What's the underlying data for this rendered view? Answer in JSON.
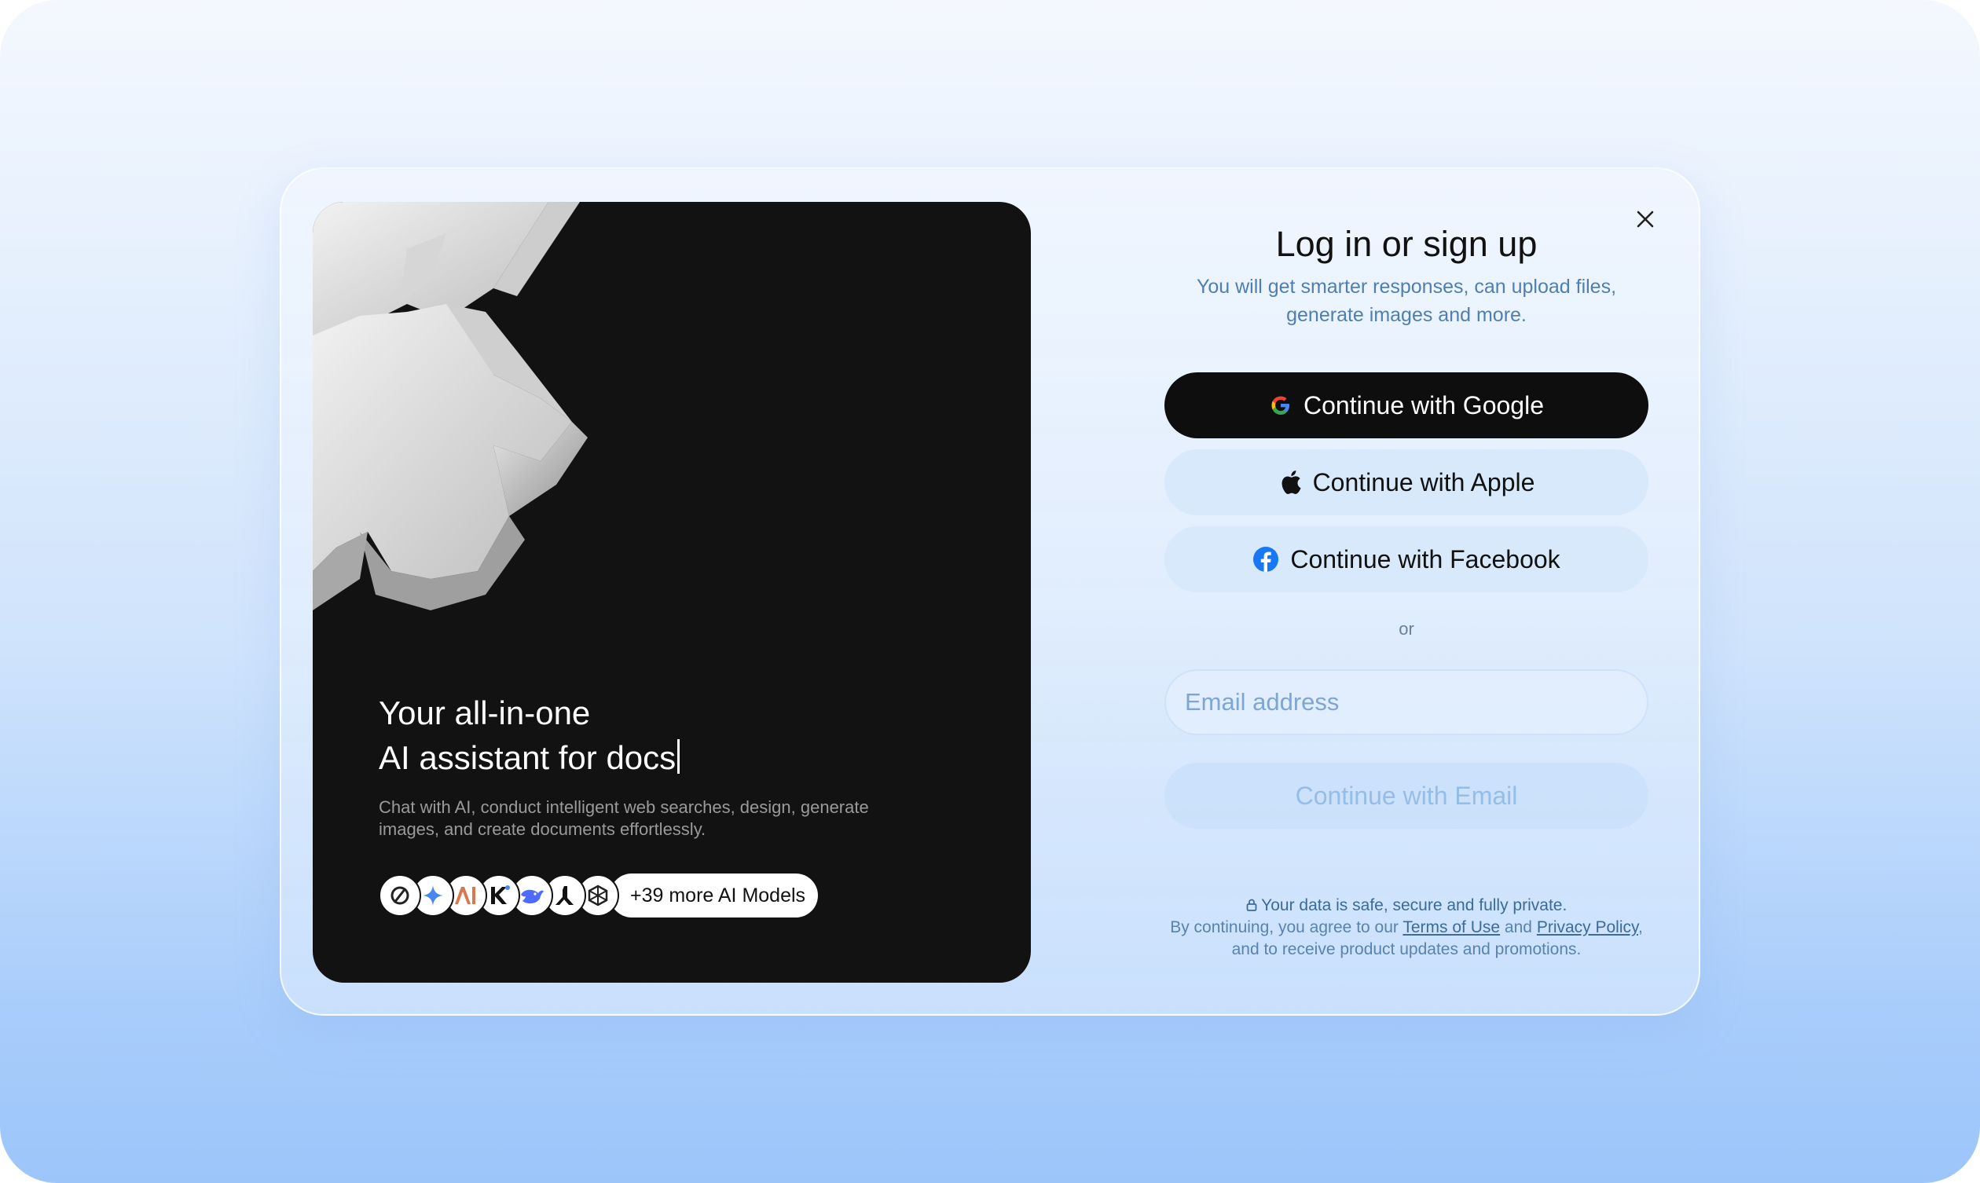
{
  "modal": {
    "close_icon": "close-icon",
    "title": "Log in or sign up",
    "subtitle_line1": "You will get smarter responses, can upload files,",
    "subtitle_line2": "generate images and more."
  },
  "hero": {
    "title_line1": "Your all-in-one",
    "title_line2": "AI assistant for docs",
    "description_line1": "Chat with AI, conduct intelligent web searches, design, generate",
    "description_line2": "images, and create documents effortlessly.",
    "model_icons": [
      "openai-icon",
      "gemini-icon",
      "anthropic-icon",
      "kimi-icon",
      "deepseek-icon",
      "mistral-icon",
      "perplexity-icon"
    ],
    "more_models": "+39 more AI Models"
  },
  "auth": {
    "google_label": "Continue with Google",
    "apple_label": "Continue with Apple",
    "facebook_label": "Continue with Facebook",
    "or_label": "or",
    "email_placeholder": "Email address",
    "email_button_label": "Continue with Email"
  },
  "footer": {
    "safe_text": "Your data is safe, secure and fully private.",
    "agree_prefix": "By continuing, you agree to our",
    "terms_link": "Terms of Use",
    "and": "and",
    "privacy_link": "Privacy Policy",
    "suffix": ",",
    "line3": "and to receive product updates and promotions."
  },
  "colors": {
    "primary_button": "#0e0e0e",
    "accent_text": "#4f7fb0",
    "hero_bg": "#121212"
  }
}
